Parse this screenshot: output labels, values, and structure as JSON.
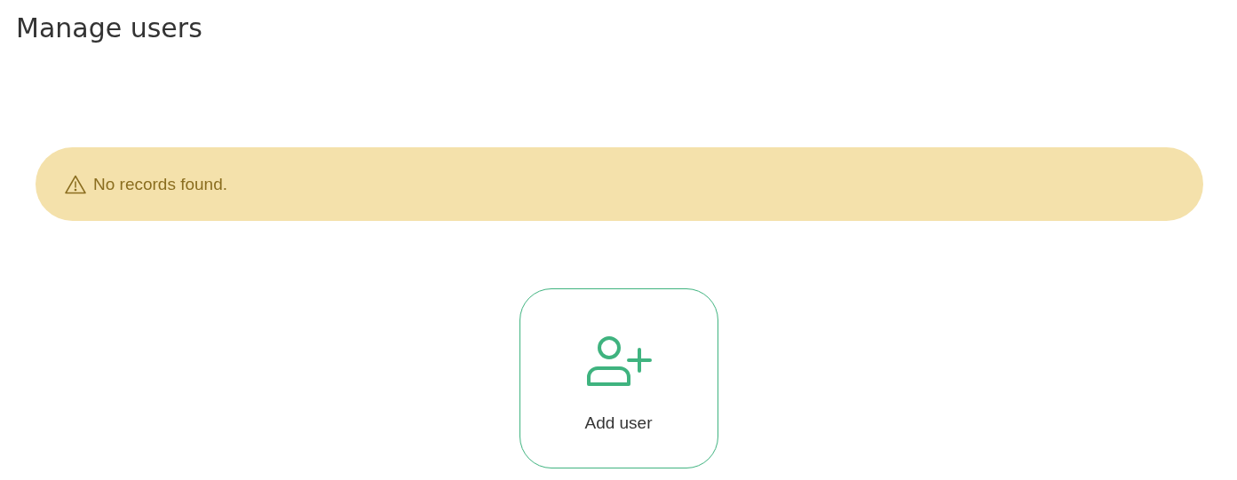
{
  "title": "Manage users",
  "alert": {
    "kind": "warning",
    "message": "No records found."
  },
  "add_button": {
    "label": "Add user"
  }
}
